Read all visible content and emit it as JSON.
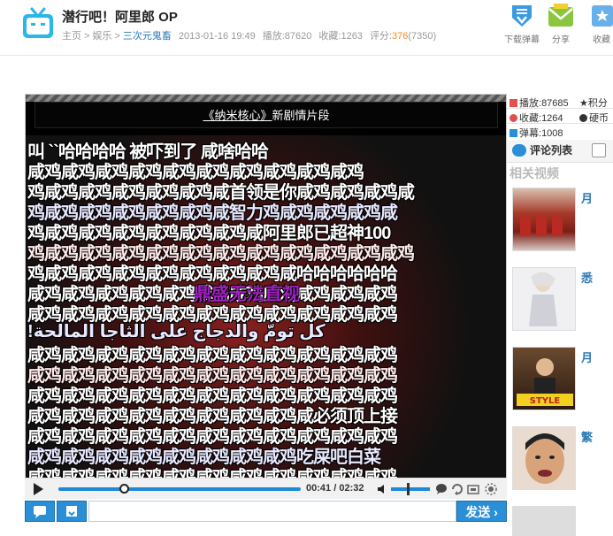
{
  "header": {
    "title": "潜行吧！阿里郎 OP",
    "breadcrumb": [
      "主页",
      "娱乐",
      "三次元鬼畜"
    ],
    "breadcrumb_sep": ">",
    "datetime": "2013-01-16 19:49",
    "plays_label": "播放:",
    "plays_value": "87620",
    "favorites_label": "收藏:",
    "favorites_value": "1263",
    "score_label": "评分:",
    "score_value": "376",
    "score_count": "(7350)",
    "actions": [
      {
        "label": "下载弹幕",
        "icon": "download-danmaku-icon"
      },
      {
        "label": "分享",
        "icon": "share-envelope-icon"
      },
      {
        "label": "收藏",
        "icon": "favorite-icon"
      }
    ]
  },
  "player": {
    "banner_prefix": "",
    "banner_title": "《纳米核心》",
    "banner_suffix": "新剧情片段",
    "danmaku_rows": [
      "叫  ``哈哈哈哈  被吓到了   咸啥哈哈",
      "咸鸡咸鸡咸鸡咸鸡咸鸡咸鸡咸鸡咸鸡咸鸡咸鸡",
      "鸡咸鸡咸鸡咸鸡咸鸡咸鸡咸首领是你咸鸡咸鸡咸鸡咸",
      "鸡咸鸡咸鸡咸鸡咸鸡咸鸡咸智力鸡咸鸡咸鸡咸鸡咸",
      "鸡咸鸡咸鸡咸鸡咸鸡咸鸡咸鸡咸阿里郎已超神100",
      "鸡咸鸡咸鸡咸鸡咸鸡咸鸡咸鸡咸鸡咸鸡咸鸡咸鸡咸鸡",
      "鸡咸鸡咸鸡咸鸡咸鸡咸鸡咸鸡咸鸡咸哈哈哈哈哈哈",
      "咸鸡咸鸡咸鸡咸鸡咸鸡咸鸡咸鸡咸鸡咸鸡咸鸡咸鸡",
      "咸鸡咸鸡咸鸡咸鸡咸鸡咸鸡咸鸡咸鸡咸鸡咸鸡咸鸡",
      "!كل تومّ والدجاج على الثاجا المالحة",
      "咸鸡咸鸡咸鸡咸鸡咸鸡咸鸡咸鸡咸鸡咸鸡咸鸡咸鸡",
      "咸鸡咸鸡咸鸡咸鸡咸鸡咸鸡咸鸡咸鸡咸鸡咸鸡咸鸡",
      "咸鸡咸鸡咸鸡咸鸡咸鸡咸鸡咸鸡咸鸡咸鸡咸鸡咸鸡",
      "咸鸡咸鸡咸鸡咸鸡咸鸡咸鸡咸鸡咸鸡咸必须顶上接",
      "咸鸡咸鸡咸鸡咸鸡咸鸡咸鸡咸鸡咸鸡咸鸡咸鸡咸鸡",
      "咸鸡咸鸡咸鸡咸鸡咸鸡咸鸡咸鸡咸鸡吃屎吧白菜",
      "咸鸡咸鸡咸鸡咸鸡咸鸡咸鸡咸鸡咸鸡咸鸡咸鸡咸鸡"
    ],
    "danmaku_accent": "鼎盛无法直视",
    "current_time": "00:41",
    "time_sep": "/",
    "duration": "02:32",
    "progress": 0.27,
    "volume": 0.4
  },
  "comment": {
    "placeholder": "",
    "send_label": "发送"
  },
  "side": {
    "stats": [
      {
        "label": "播放:",
        "value": "87685",
        "icon_color": "#e05050"
      },
      {
        "label": "积分",
        "value": "",
        "icon_color": "#333333"
      },
      {
        "label": "收藏:",
        "value": "1264",
        "icon_color": "#e05050"
      },
      {
        "label": "硬币",
        "value": "",
        "icon_color": "#333333"
      },
      {
        "label": "弹幕:",
        "value": "1008",
        "icon_color": "#2a8fd6"
      }
    ],
    "tab_comments": "评论列表",
    "related_title": "相关视频",
    "related": [
      {
        "cap": "月"
      },
      {
        "cap": "悉"
      },
      {
        "cap": "月"
      },
      {
        "cap": "繁"
      }
    ]
  },
  "colors": {
    "accent": "#2a8fd6",
    "link": "#2a7ab5",
    "score": "#f08c1e"
  }
}
